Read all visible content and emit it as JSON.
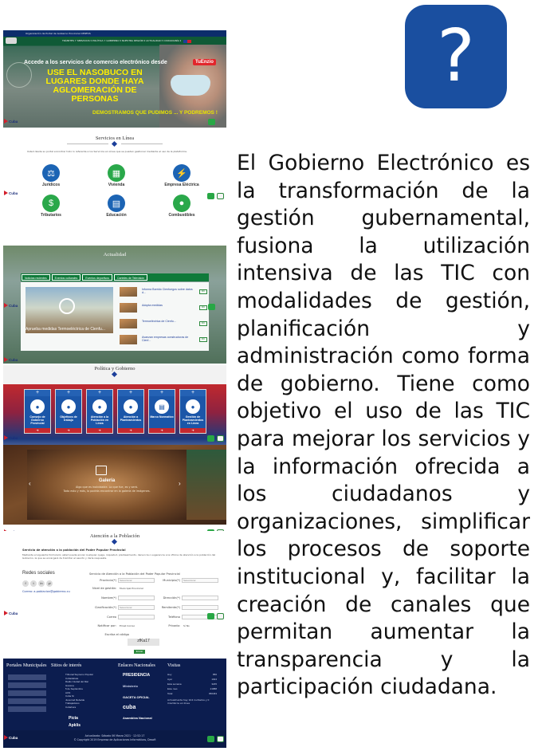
{
  "help_badge": {
    "symbol": "?",
    "color": "#1a4fa0"
  },
  "description": "El Gobierno Electrónico es la transformación de la gestión gubernamental, fusiona la utilización intensiva de las TIC con modalidades de gestión, planificación y administración como forma de gobierno. Tiene como objetivo el uso de las TIC para mejorar los servicios y la información ofrecida a los ciudadanos y organizaciones, simplificar los procesos de soporte institucional y, facilitar la creación de canales que permitan aumentar la transparencia y la participación ciudadana.",
  "site": {
    "cuba_label": "Cuba",
    "fab_up": "^",
    "hero": {
      "topbar_text": "Organización de Portal de Gobierno Provincial   CENFOS",
      "menu_text": "TRÁMITES Y SERVICIOS ▾   POLÍTICA Y GOBIERNO ▾   NUESTRA REGIÓN ▾   ACTUALIDAD ▾   CIUDADANÍA ▾",
      "headline_small": "Accede a los servicios de comercio electrónico desde",
      "headline_big": "USE EL NASOBUCO EN LUGARES DONDE HAYA AGLOMERACIÓN DE PERSONAS",
      "badge": "TuEnzio",
      "slogan": "DEMOSTRAMOS QUE PUDIMOS ... Y PODREMOS !"
    },
    "servicios": {
      "title": "Servicios en Línea",
      "intro": "Usted desde su portal encontrar todo lo referente a los Servicios en Línea que se pueden gestionar mediante el uso de la plataforma.",
      "items": [
        {
          "label": "Jurídicos",
          "icon": "gavel-icon",
          "glyph": "⚖",
          "color": "#1c64b4"
        },
        {
          "label": "Vivienda",
          "icon": "building-icon",
          "glyph": "▦",
          "color": "#2aa84a"
        },
        {
          "label": "Empresa Eléctrica",
          "icon": "bolt-icon",
          "glyph": "⚡",
          "color": "#1c64b4"
        },
        {
          "label": "Tributarios",
          "icon": "money-icon",
          "glyph": "$",
          "color": "#2aa84a"
        },
        {
          "label": "Educación",
          "icon": "book-icon",
          "glyph": "▤",
          "color": "#1c64b4"
        },
        {
          "label": "Combustibles",
          "icon": "drop-icon",
          "glyph": "●",
          "color": "#2aa84a"
        }
      ]
    },
    "actualidad": {
      "title": "Actualidad",
      "tabs": [
        "Noticias recientes",
        "Eventos culturales",
        "Eventos deportivos",
        "Carteles de Televisión"
      ],
      "main_caption": "Aprueba medidas Termoeléctrica de Cienfu...",
      "news": [
        {
          "text": "Informa Barrido Cienfuegos sobre datos d...",
          "date": "DIC"
        },
        {
          "text": "Adopta medidas",
          "date": "DIC"
        },
        {
          "text": "Termoeléctrica de Cienfu...",
          "date": "DIC"
        },
        {
          "text": "Avanzan empresas constructoras de Cienf...",
          "date": "DIC"
        }
      ]
    },
    "politica": {
      "title": "Política y Gobierno",
      "cards": [
        {
          "label": "Consejo de Gobierno Provincial",
          "icon": "group-icon"
        },
        {
          "label": "Objetivos de trabajo",
          "icon": "target-icon"
        },
        {
          "label": "Atención a la Población en Línea",
          "icon": "people-icon"
        },
        {
          "label": "Atención a Planteamientos",
          "icon": "audience-icon"
        },
        {
          "label": "Marco Normativo",
          "icon": "document-icon"
        },
        {
          "label": "Gestión de Planteamientos en Línea",
          "icon": "network-icon"
        }
      ]
    },
    "galeria": {
      "title": "Galería",
      "sub1": "Algo que es inolvidable. Lo que fue, es y será.",
      "sub2": "Todo esto y más, lo podrás encontrar en la galería de imágenes."
    },
    "atencion": {
      "title": "Atención a la Población",
      "heading": "Servicio de atención a la población del Poder Popular Provincial",
      "paragraph": "Mediante el siguiente formulario usted puede enviar cualquier queja, inquietud, planteamiento, denuncia o sugerencia a la oficina de atención a la población del Gobierno, la que se encargará de tramitar el asunto y darle respuesta.",
      "redes": "Redes sociales",
      "social": [
        "f",
        "t",
        "in",
        "yt"
      ],
      "contact": "Correo: a.poblacion@gobierno.cu",
      "form_heading": "Servicio de Atención a la Población del Poder Popular Provincial",
      "fields": [
        {
          "label": "Provincia(*)",
          "value": "Seleccionar"
        },
        {
          "label": "Municipio(*)",
          "value": "Seleccionar"
        },
        {
          "label": "Nivel de gestión:",
          "value": "Municipal   Provincial"
        },
        {
          "label": "Nombre(*)",
          "value": ""
        },
        {
          "label": "Dirección(*)",
          "value": ""
        },
        {
          "label": "Clasificación(*)",
          "value": "Seleccionar"
        },
        {
          "label": "Remitente(*)",
          "value": ""
        },
        {
          "label": "Correo",
          "value": ""
        },
        {
          "label": "Teléfono",
          "value": ""
        },
        {
          "label": "Notificar por:",
          "value": "Email   Correo"
        },
        {
          "label": "Privado:",
          "value": "Sí   No"
        }
      ],
      "captcha_label": "Escriba el código",
      "captcha": "zfKa17",
      "send": "Enviar"
    },
    "footer": {
      "cols": [
        "Portales Municipales",
        "Sitios de interés",
        "Enlaces Nacionales",
        "Visitas"
      ],
      "sitios": [
        "Tribunal Supremo Popular",
        "Cubadebate",
        "Radio Ciudad del Mar",
        "Granma",
        "5 de Septiembre",
        "ACN",
        "Cuba Sí",
        "Juventud Rebelde",
        "Trabajadores",
        "Cubahora"
      ],
      "enlaces": [
        "PRESIDENCIA",
        "Ministerio",
        "GACETA OFICIAL",
        "cuba",
        "Asamblea Nacional"
      ],
      "visitas": [
        {
          "k": "Hoy",
          "v": "856"
        },
        {
          "k": "Ayer",
          "v": "1024"
        },
        {
          "k": "Esta semana",
          "v": "3245"
        },
        {
          "k": "Este mes",
          "v": "21888"
        },
        {
          "k": "Total",
          "v": "956463"
        }
      ],
      "visitas_note": "Actualmente hay 104 invitados y 0 miembros en línea",
      "logos": [
        "Picta",
        "Apklis"
      ],
      "copy1": "Actualizado: Sábado 06 Marzo 2021 · 12:52:17",
      "copy2": "© Copyright 2019 Empresa de Aplicaciones Informáticas, Desoft"
    }
  }
}
